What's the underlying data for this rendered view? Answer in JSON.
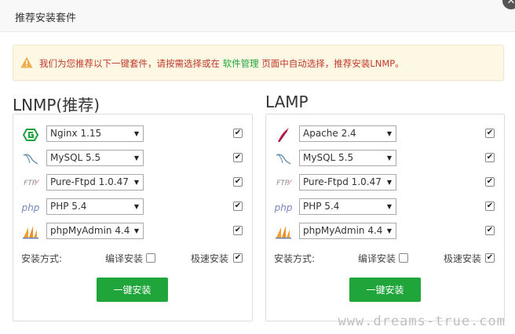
{
  "dialog": {
    "title": "推荐安装套件",
    "close_symbol": "✕"
  },
  "notice": {
    "prefix": "我们为您推荐以下一键套件，请按需选择或在 ",
    "link": "软件管理",
    "suffix": " 页面中自动选择，推荐安装LNMP。"
  },
  "lnmp": {
    "title": "LNMP(推荐)",
    "items": [
      {
        "icon": "nginx-icon",
        "value": "Nginx 1.15",
        "checked": true
      },
      {
        "icon": "mysql-icon",
        "value": "MySQL 5.5",
        "checked": true
      },
      {
        "icon": "ftp-icon",
        "value": "Pure-Ftpd 1.0.47",
        "checked": true
      },
      {
        "icon": "php-icon",
        "value": "PHP 5.4",
        "checked": true
      },
      {
        "icon": "phpmyadmin-icon",
        "value": "phpMyAdmin 4.4",
        "checked": true
      }
    ],
    "method_label": "安装方式:",
    "option_compile": "编译安装",
    "option_fast": "极速安装",
    "compile_checked": false,
    "fast_checked": true,
    "install_label": "一键安装"
  },
  "lamp": {
    "title": "LAMP",
    "items": [
      {
        "icon": "apache-icon",
        "value": "Apache 2.4",
        "checked": true
      },
      {
        "icon": "mysql-icon",
        "value": "MySQL 5.5",
        "checked": true
      },
      {
        "icon": "ftp-icon",
        "value": "Pure-Ftpd 1.0.47",
        "checked": true
      },
      {
        "icon": "php-icon",
        "value": "PHP 5.4",
        "checked": true
      },
      {
        "icon": "phpmyadmin-icon",
        "value": "phpMyAdmin 4.4",
        "checked": true
      }
    ],
    "method_label": "安装方式:",
    "option_compile": "编译安装",
    "option_fast": "极速安装",
    "compile_checked": false,
    "fast_checked": true,
    "install_label": "一键安装"
  },
  "icon_labels": {
    "ftp": "FTP",
    "php": "php"
  },
  "watermark": "www.dreams-true.com",
  "colors": {
    "accent": "#20a53a",
    "warning_text": "#c0392b",
    "notice_bg": "#fcf8e3"
  }
}
